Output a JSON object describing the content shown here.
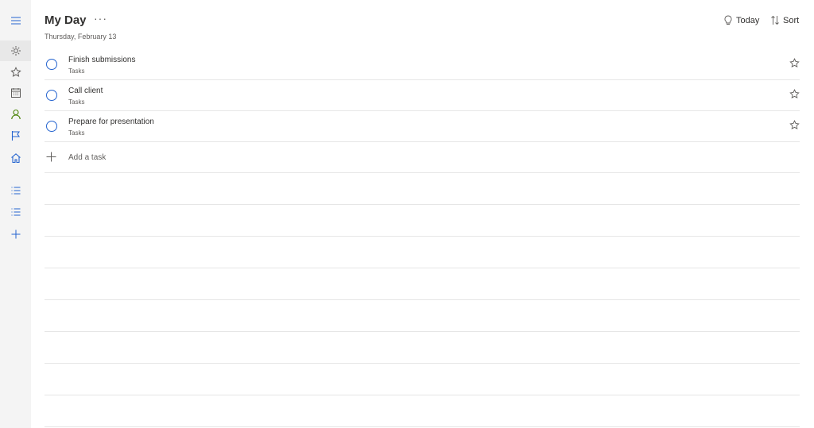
{
  "app": {
    "title": "My Day",
    "more_label": "···",
    "date": "Thursday, February 13",
    "accent_color": "#2564cf"
  },
  "toolbar": {
    "today_label": "Today",
    "sort_label": "Sort"
  },
  "sidebar": {
    "items": [
      {
        "icon": "hamburger-menu-icon"
      },
      {
        "icon": "sun-icon",
        "active": true
      },
      {
        "icon": "star-icon"
      },
      {
        "icon": "calendar-icon"
      },
      {
        "icon": "person-icon"
      },
      {
        "icon": "flag-icon"
      },
      {
        "icon": "home-icon"
      },
      {
        "icon": "list-icon"
      },
      {
        "icon": "list-icon"
      },
      {
        "icon": "plus-icon"
      }
    ]
  },
  "tasks": [
    {
      "name": "Finish submissions",
      "list": "Tasks"
    },
    {
      "name": "Call client",
      "list": "Tasks"
    },
    {
      "name": "Prepare for presentation",
      "list": "Tasks"
    }
  ],
  "add_task": {
    "placeholder": "Add a task"
  }
}
